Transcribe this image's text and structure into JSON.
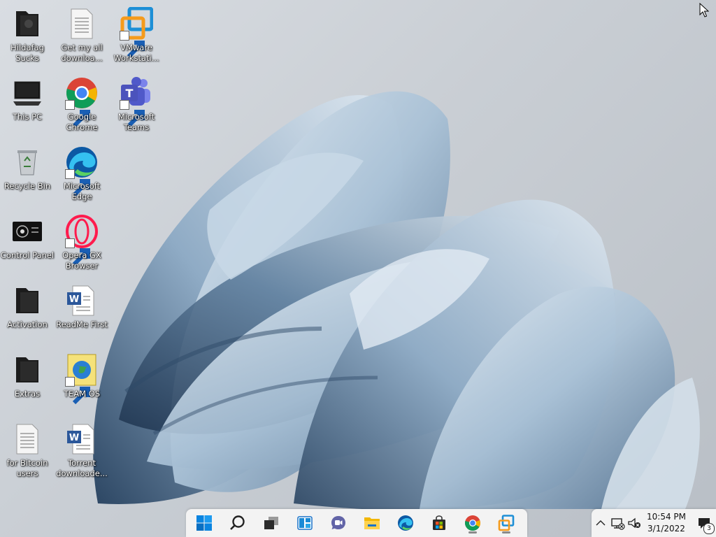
{
  "desktop": {
    "icons": [
      {
        "label": "Hildafag Sucks",
        "icon": "folder-icon"
      },
      {
        "label": "Get my all downloa...",
        "icon": "text-file-icon"
      },
      {
        "label": "VMware Workstati...",
        "icon": "vmware-icon"
      },
      {
        "label": "This PC",
        "icon": "computer-icon"
      },
      {
        "label": "Google Chrome",
        "icon": "chrome-icon"
      },
      {
        "label": "Microsoft Teams",
        "icon": "teams-icon"
      },
      {
        "label": "Recycle Bin",
        "icon": "recycle-bin-icon"
      },
      {
        "label": "Microsoft Edge",
        "icon": "edge-icon"
      },
      {
        "label": "Control Panel",
        "icon": "control-panel-icon"
      },
      {
        "label": "Opera GX Browser",
        "icon": "opera-icon"
      },
      {
        "label": "Activation",
        "icon": "folder-icon"
      },
      {
        "label": "ReadMe First",
        "icon": "word-doc-icon"
      },
      {
        "label": "Extras",
        "icon": "folder-icon"
      },
      {
        "label": "TEAM OS",
        "icon": "globe-icon"
      },
      {
        "label": "for Bitcoin users",
        "icon": "text-file-icon"
      },
      {
        "label": "Torrent downloade...",
        "icon": "word-doc-icon"
      }
    ]
  },
  "taskbar": {
    "apps": [
      {
        "name": "start",
        "icon": "windows-start-icon"
      },
      {
        "name": "search",
        "icon": "search-icon"
      },
      {
        "name": "task-view",
        "icon": "task-view-icon"
      },
      {
        "name": "widgets",
        "icon": "widgets-icon"
      },
      {
        "name": "chat",
        "icon": "chat-icon"
      },
      {
        "name": "file-explorer",
        "icon": "file-explorer-icon"
      },
      {
        "name": "edge",
        "icon": "edge-icon"
      },
      {
        "name": "store",
        "icon": "store-icon"
      },
      {
        "name": "chrome",
        "icon": "chrome-icon",
        "running": true
      },
      {
        "name": "vmware",
        "icon": "vmware-icon",
        "running": true
      }
    ]
  },
  "tray": {
    "time": "10:54 PM",
    "date": "3/1/2022",
    "notifications_count": "3",
    "icons": [
      "chevron-up-icon",
      "network-icon",
      "volume-muted-icon",
      "notification-icon"
    ]
  },
  "colors": {
    "wallpaper_petal": "#a9c1d6",
    "wallpaper_shadow": "#3d5a78",
    "taskbar": "#f3f3f3",
    "accent": "#0078d4"
  }
}
